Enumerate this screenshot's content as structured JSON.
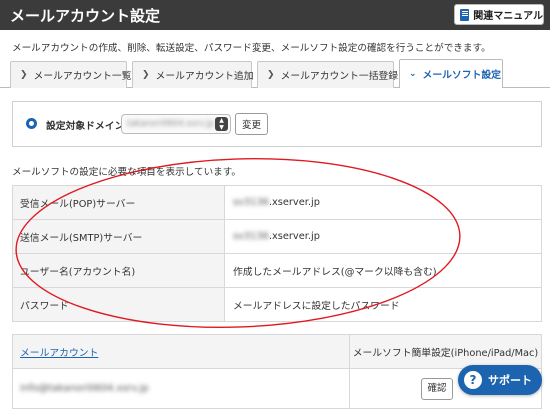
{
  "header": {
    "title": "メールアカウント設定",
    "manual_label": "関連マニュアル"
  },
  "description": "メールアカウントの作成、削除、転送設定、パスワード変更、メールソフト設定の確認を行うことができます。",
  "tabs": [
    {
      "label": "メールアカウント一覧",
      "active": false
    },
    {
      "label": "メールアカウント追加",
      "active": false
    },
    {
      "label": "メールアカウント一括登録",
      "active": false
    },
    {
      "label": "メールソフト設定",
      "active": true
    }
  ],
  "domain": {
    "label": "設定対象ドメイン",
    "value": "takanori0604.xsrv.jp",
    "change_label": "変更"
  },
  "intro": "メールソフトの設定に必要な項目を表示しています。",
  "settings": [
    {
      "key": "受信メール(POP)サーバー",
      "value_blur": "sv3136",
      "value": ".xserver.jp"
    },
    {
      "key": "送信メール(SMTP)サーバー",
      "value_blur": "sv3136",
      "value": ".xserver.jp"
    },
    {
      "key": "ユーザー名(アカウント名)",
      "value_blur": "",
      "value": "作成したメールアドレス(@マーク以降も含む)"
    },
    {
      "key": "パスワード",
      "value_blur": "",
      "value": "メールアドレスに設定したパスワード"
    }
  ],
  "accounts": {
    "col_account": "メールアカウント",
    "col_setting": "メールソフト簡単設定(iPhone/iPad/Mac)",
    "rows": [
      {
        "email": "info@takanori0604.xsrv.jp",
        "button": "確認"
      }
    ]
  },
  "support": {
    "label": "サポート"
  },
  "colors": {
    "accent": "#1d64b0",
    "header_bg": "#3b3b3b",
    "annotation": "#e0191f"
  },
  "icons": [
    "book-icon",
    "chevron-right-icon",
    "chevron-down-icon",
    "radio-selected-icon",
    "select-arrows-icon",
    "question-icon"
  ]
}
